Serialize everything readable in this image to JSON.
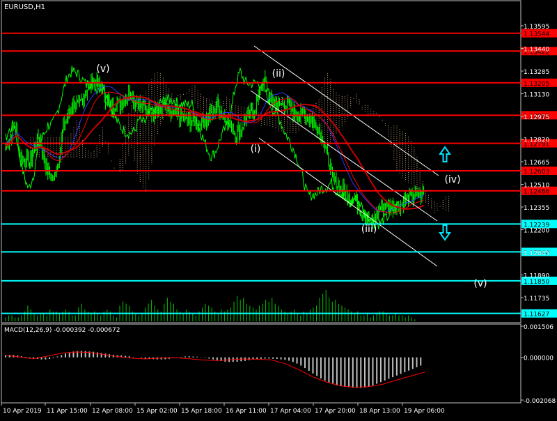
{
  "window": {
    "symbol_title": "EURUSD,H1"
  },
  "indicator": {
    "title": "MACD(12,26,9) -0.000392 -0.000672"
  },
  "colors": {
    "background": "#000000",
    "frame": "#c0c0c0",
    "candles": "#00ff00",
    "chikou": "#00ff00",
    "resistance": "#ff0000",
    "support": "#00ffff",
    "resistance_label_bg": "#ff0000",
    "support_label_bg": "#00ffff",
    "ma_fast": "#ff0000",
    "ma_slow": "#cc0000",
    "kijun": "#3333ff",
    "cloud": "#c8a882",
    "channel": "#ffffff",
    "wave_labels": "#ffffff",
    "arrow": "#00e5ff",
    "volume": "#00c800",
    "macd_hist": "#c0c0c0",
    "macd_signal": "#ff0000",
    "axis_text": "#ffffff"
  },
  "chart_data": [
    {
      "type": "candlestick",
      "title": "EURUSD,H1",
      "x_ticks": [
        "10 Apr 2019",
        "11 Apr 15:00",
        "12 Apr 08:00",
        "15 Apr 02:00",
        "15 Apr 18:00",
        "16 Apr 11:00",
        "17 Apr 04:00",
        "17 Apr 20:00",
        "18 Apr 13:00",
        "19 Apr 06:00"
      ],
      "y_ticks": [
        "1.13595",
        "1.13440",
        "1.13285",
        "1.13130",
        "1.12975",
        "1.12820",
        "1.12665",
        "1.12510",
        "1.12355",
        "1.12200",
        "1.12045",
        "1.11890",
        "1.11735"
      ],
      "ylim": [
        1.116,
        1.137
      ],
      "price_path": [
        [
          0,
          1.1277
        ],
        [
          5,
          1.1284
        ],
        [
          10,
          1.1292
        ],
        [
          15,
          1.1271
        ],
        [
          20,
          1.1268
        ],
        [
          25,
          1.1266
        ],
        [
          30,
          1.1275
        ],
        [
          35,
          1.1284
        ],
        [
          40,
          1.1268
        ],
        [
          45,
          1.1258
        ],
        [
          50,
          1.1254
        ],
        [
          55,
          1.1268
        ],
        [
          60,
          1.129
        ],
        [
          65,
          1.1299
        ],
        [
          70,
          1.1306
        ],
        [
          75,
          1.1304
        ],
        [
          80,
          1.1309
        ],
        [
          85,
          1.1316
        ],
        [
          90,
          1.1322
        ],
        [
          95,
          1.1321
        ],
        [
          100,
          1.1316
        ],
        [
          105,
          1.1309
        ],
        [
          110,
          1.1304
        ],
        [
          115,
          1.1307
        ],
        [
          120,
          1.1305
        ],
        [
          125,
          1.131
        ],
        [
          130,
          1.1314
        ],
        [
          135,
          1.1308
        ],
        [
          140,
          1.1305
        ],
        [
          145,
          1.1303
        ],
        [
          150,
          1.1302
        ],
        [
          155,
          1.1301
        ],
        [
          160,
          1.1301
        ],
        [
          165,
          1.1306
        ],
        [
          170,
          1.1299
        ],
        [
          175,
          1.1299
        ],
        [
          180,
          1.1298
        ],
        [
          185,
          1.1297
        ],
        [
          190,
          1.1295
        ],
        [
          195,
          1.1294
        ],
        [
          200,
          1.1294
        ],
        [
          205,
          1.1293
        ],
        [
          210,
          1.1296
        ],
        [
          215,
          1.13
        ],
        [
          220,
          1.1306
        ],
        [
          225,
          1.13
        ],
        [
          230,
          1.1295
        ],
        [
          235,
          1.129
        ],
        [
          240,
          1.1285
        ],
        [
          245,
          1.1289
        ],
        [
          250,
          1.1296
        ],
        [
          255,
          1.1299
        ],
        [
          260,
          1.1303
        ],
        [
          265,
          1.1317
        ],
        [
          270,
          1.1322
        ],
        [
          275,
          1.131
        ],
        [
          280,
          1.1306
        ],
        [
          285,
          1.1305
        ],
        [
          290,
          1.1306
        ],
        [
          295,
          1.1304
        ],
        [
          300,
          1.13
        ],
        [
          305,
          1.1298
        ],
        [
          310,
          1.13
        ],
        [
          315,
          1.1296
        ],
        [
          320,
          1.1294
        ],
        [
          325,
          1.129
        ],
        [
          330,
          1.1283
        ],
        [
          335,
          1.127
        ],
        [
          340,
          1.1255
        ],
        [
          345,
          1.1251
        ],
        [
          350,
          1.1247
        ],
        [
          355,
          1.1245
        ],
        [
          360,
          1.1241
        ],
        [
          365,
          1.124
        ],
        [
          370,
          1.1232
        ],
        [
          375,
          1.123
        ],
        [
          380,
          1.1225
        ],
        [
          385,
          1.1227
        ],
        [
          390,
          1.1236
        ],
        [
          395,
          1.1237
        ],
        [
          400,
          1.1235
        ],
        [
          405,
          1.1237
        ],
        [
          410,
          1.1237
        ],
        [
          415,
          1.1239
        ],
        [
          420,
          1.1242
        ],
        [
          425,
          1.1243
        ],
        [
          430,
          1.1244
        ],
        [
          435,
          1.1244
        ]
      ],
      "horizontal_levels": {
        "resistance": [
          "1.13544",
          "1.13422",
          "1.13205",
          "1.12983",
          "1.12791",
          "1.12603",
          "1.12466"
        ],
        "support": [
          "1.12239",
          "1.12048",
          "1.11850",
          "1.11627"
        ]
      },
      "wave_labels": [
        "(v)",
        "(ii)",
        "(i)",
        "(iii)",
        "(iv)",
        "(v)"
      ],
      "volume": [
        2,
        3,
        3,
        2,
        2,
        3,
        5,
        8,
        6,
        4,
        3,
        4,
        4,
        3,
        6,
        5,
        5,
        4,
        5,
        6,
        5,
        3,
        3,
        7,
        9,
        6,
        5,
        4,
        5,
        4,
        3,
        5,
        6,
        5,
        3,
        2,
        8,
        10,
        9,
        8,
        5,
        4,
        3,
        4,
        7,
        9,
        11,
        8,
        6,
        5,
        9,
        12,
        10,
        9,
        6,
        5,
        4,
        6,
        5,
        4,
        3,
        5,
        7,
        9,
        8,
        7,
        5,
        4,
        6,
        5,
        6,
        7,
        10,
        13,
        11,
        12,
        9,
        8,
        7,
        6,
        8,
        9,
        11,
        10,
        12,
        9,
        8,
        6,
        5,
        4,
        5,
        6,
        4,
        3,
        5,
        4,
        6,
        7,
        8,
        12,
        14,
        16,
        12,
        10,
        11,
        9,
        8,
        7,
        6,
        5,
        4,
        5,
        3,
        3,
        4,
        2,
        3,
        4,
        5,
        5,
        4,
        3,
        3,
        4,
        3,
        3,
        2,
        3,
        2,
        1
      ]
    },
    {
      "type": "bar",
      "title": "MACD(12,26,9) -0.000392 -0.000672",
      "y_ticks": [
        "0.001506",
        "0.000000",
        "-0.002068"
      ],
      "ylim": [
        -0.002068,
        0.001506
      ],
      "histogram": [
        0.0001,
        0.00012,
        0.00011,
        9e-05,
        5e-05,
        2e-05,
        -3e-05,
        -6e-05,
        -8e-05,
        -0.0001,
        -0.0001,
        -8e-05,
        -3e-05,
        4e-05,
        0.00011,
        0.00018,
        0.00024,
        0.00028,
        0.0003,
        0.00031,
        0.0003,
        0.00028,
        0.00027,
        0.00024,
        0.00021,
        0.00018,
        0.00015,
        0.00012,
        0.0001,
        9e-05,
        7e-05,
        5e-05,
        2e-05,
        0.0,
        -3e-05,
        -6e-05,
        -8e-05,
        -9e-05,
        -0.0001,
        -0.0001,
        -9e-05,
        -7e-05,
        -4e-05,
        -1e-05,
        2e-05,
        4e-05,
        5e-05,
        4e-05,
        3e-05,
        1e-05,
        -2e-05,
        -6e-05,
        -0.0001,
        -0.00014,
        -0.00018,
        -0.00021,
        -0.00022,
        -0.00022,
        -0.00021,
        -0.00019,
        -0.00017,
        -0.00014,
        -0.00011,
        -9e-05,
        -7e-05,
        -6e-05,
        -6e-05,
        -7e-05,
        -8e-05,
        -0.0001,
        -0.00012,
        -0.00016,
        -0.00022,
        -0.0003,
        -0.0004,
        -0.00052,
        -0.00065,
        -0.00078,
        -0.0009,
        -0.00102,
        -0.00112,
        -0.00122,
        -0.0013,
        -0.00136,
        -0.0014,
        -0.00143,
        -0.00145,
        -0.00147,
        -0.00148,
        -0.00148,
        -0.00146,
        -0.00142,
        -0.00136,
        -0.00128,
        -0.0012,
        -0.00112,
        -0.00104,
        -0.00096,
        -0.00088,
        -0.0008,
        -0.00072,
        -0.00064,
        -0.00056,
        -0.00048,
        -0.0004
      ],
      "signal": [
        [
          0,
          0.0001
        ],
        [
          10,
          2e-05
        ],
        [
          20,
          -7e-05
        ],
        [
          30,
          6e-05
        ],
        [
          40,
          0.0002
        ],
        [
          50,
          0.00026
        ],
        [
          60,
          0.00024
        ],
        [
          70,
          0.00014
        ],
        [
          80,
          4e-05
        ],
        [
          90,
          -4e-05
        ],
        [
          100,
          -8e-05
        ],
        [
          110,
          -4e-05
        ],
        [
          120,
          -1e-05
        ],
        [
          130,
          -6e-05
        ],
        [
          140,
          -0.00012
        ],
        [
          150,
          -0.00016
        ],
        [
          160,
          -0.00012
        ],
        [
          170,
          -8e-05
        ],
        [
          180,
          -9e-05
        ],
        [
          190,
          -0.00012
        ],
        [
          200,
          -0.0003
        ],
        [
          210,
          -0.0006
        ],
        [
          220,
          -0.00095
        ],
        [
          230,
          -0.0012
        ],
        [
          240,
          -0.00138
        ],
        [
          250,
          -0.00145
        ],
        [
          260,
          -0.00142
        ],
        [
          270,
          -0.0013
        ],
        [
          280,
          -0.0011
        ],
        [
          290,
          -0.0009
        ],
        [
          300,
          -0.00072
        ]
      ]
    }
  ]
}
